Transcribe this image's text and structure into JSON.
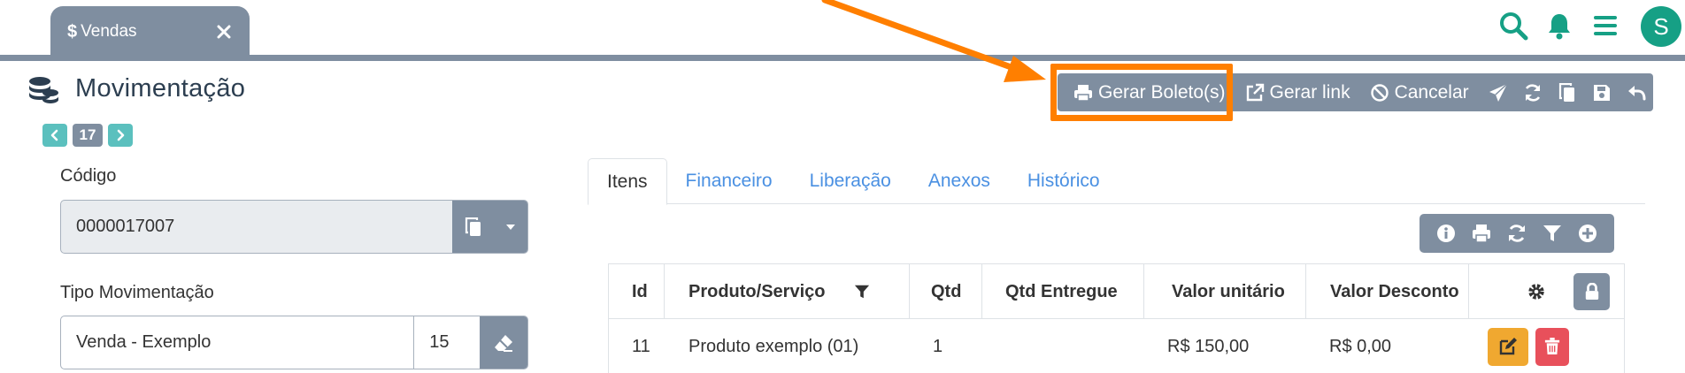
{
  "tab": {
    "icon": "dollar-icon",
    "label": "Vendas",
    "close_icon": "close-icon"
  },
  "header_icons": [
    "search-icon",
    "bell-icon",
    "menu-icon"
  ],
  "avatar": {
    "initial": "S",
    "color": "#16a085"
  },
  "page": {
    "title": "Movimentação",
    "icon": "coins-icon"
  },
  "pager": {
    "prev_icon": "chevron-left-icon",
    "number": "17",
    "next_icon": "chevron-right-icon"
  },
  "toolbar": {
    "gerar_boleto": "Gerar Boleto(s)",
    "gerar_link": "Gerar link",
    "cancelar": "Cancelar",
    "icons": [
      "print-icon",
      "external-link-icon",
      "ban-icon",
      "send-icon",
      "refresh-icon",
      "copy-icon",
      "save-icon",
      "undo-icon"
    ]
  },
  "annotation": {
    "highlight_color": "#ff7f00"
  },
  "form": {
    "codigo_label": "Código",
    "codigo_value": "0000017007",
    "tipo_label": "Tipo Movimentação",
    "tipo_value": "Venda - Exemplo",
    "tipo_code": "15"
  },
  "tabs": [
    "Itens",
    "Financeiro",
    "Liberação",
    "Anexos",
    "Histórico"
  ],
  "grid_toolbar_icons": [
    "info-icon",
    "print-icon",
    "refresh-icon",
    "filter-icon",
    "plus-icon"
  ],
  "table": {
    "columns": [
      "Id",
      "Produto/Serviço",
      "Qtd",
      "Qtd Entregue",
      "Valor unitário",
      "Valor Desconto"
    ],
    "rows": [
      {
        "id": "11",
        "produto": "Produto exemplo (01)",
        "qtd": "1",
        "qtd_entregue": "",
        "valor_unitario": "R$ 150,00",
        "valor_desconto": "R$ 0,00"
      }
    ]
  },
  "colors": {
    "slate": "#7f8ea0",
    "teal": "#16a085",
    "link": "#4a90e2",
    "edit": "#f0a830",
    "delete": "#e8505b"
  }
}
